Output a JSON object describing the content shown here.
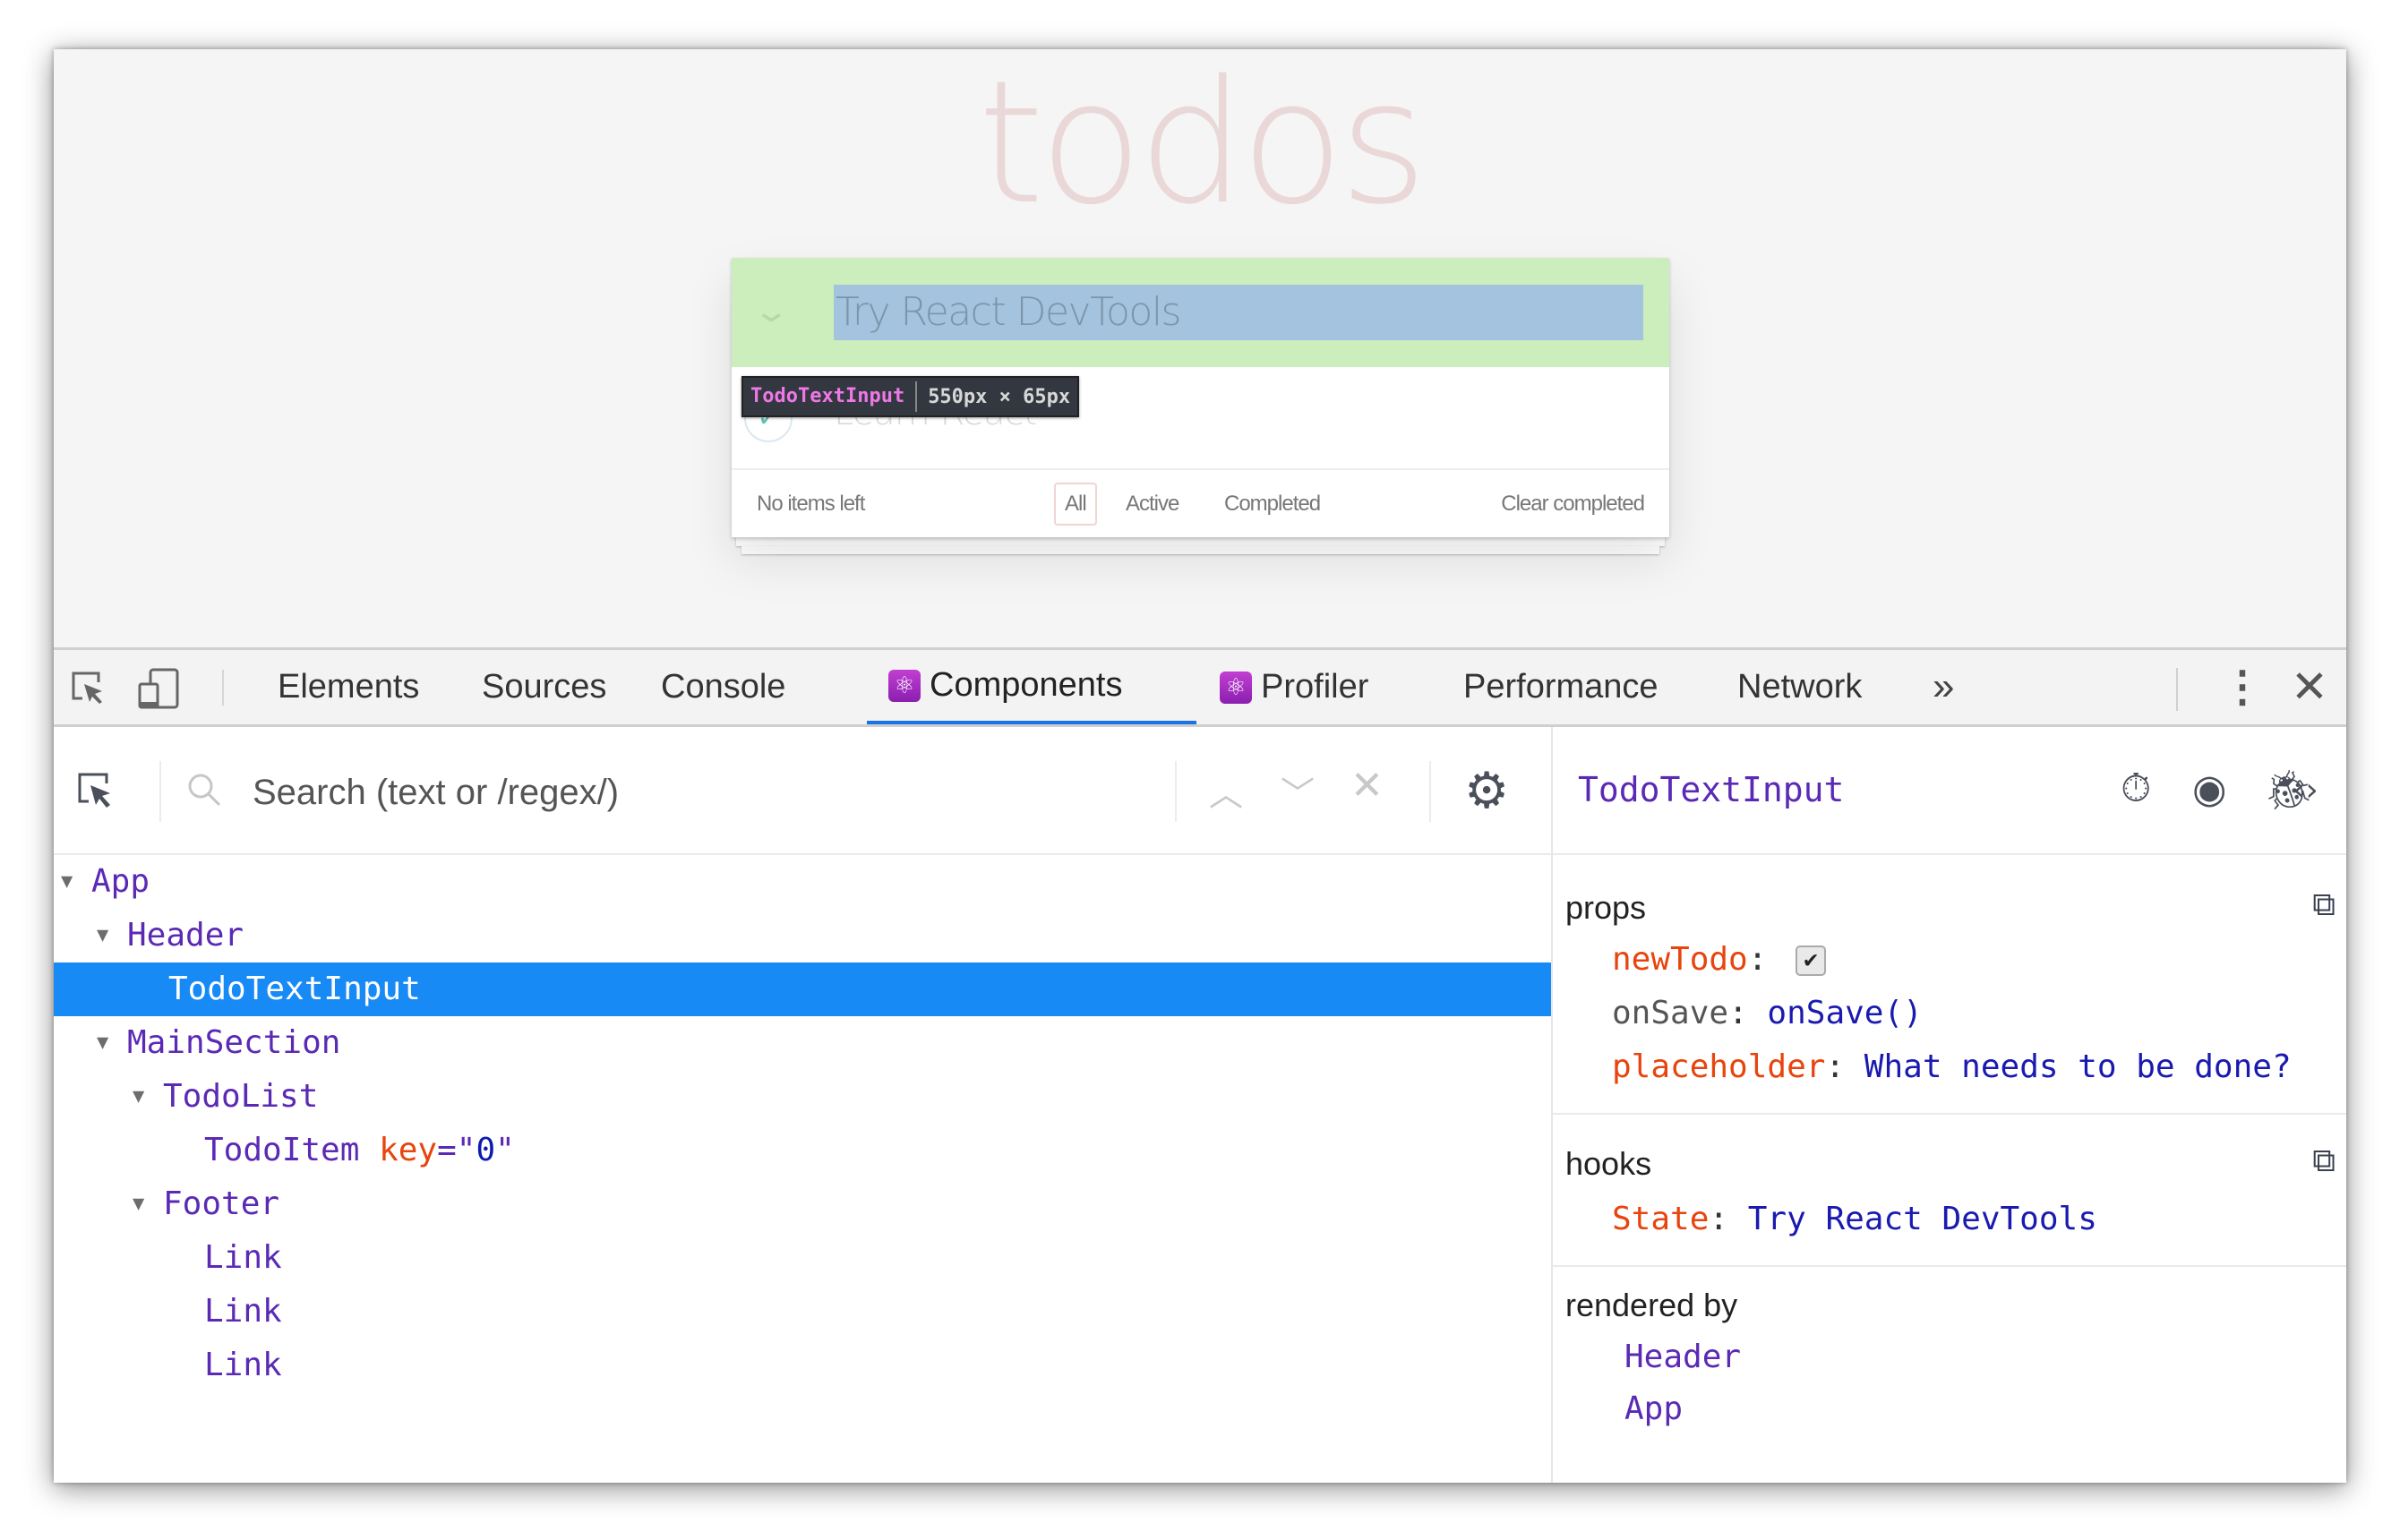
{
  "page": {
    "title": "todos",
    "new_todo_value": "Try React DevTools",
    "toggle_all_icon": "chevron-down-icon",
    "todos": [
      {
        "text": "Learn React",
        "completed": true
      }
    ],
    "footer": {
      "items_left": "No items left",
      "filters": [
        "All",
        "Active",
        "Completed"
      ],
      "selected_filter": "All",
      "clear_completed": "Clear completed"
    },
    "highlight_tooltip": {
      "component": "TodoTextInput",
      "size": "550px × 65px"
    }
  },
  "devtools": {
    "toolbar_icons": [
      "inspect-element-icon",
      "device-toggle-icon"
    ],
    "tabs": [
      {
        "label": "Elements",
        "react": false
      },
      {
        "label": "Sources",
        "react": false
      },
      {
        "label": "Console",
        "react": false
      },
      {
        "label": "Components",
        "react": true,
        "active": true
      },
      {
        "label": "Profiler",
        "react": true
      },
      {
        "label": "Performance",
        "react": false
      },
      {
        "label": "Network",
        "react": false
      }
    ],
    "more_tabs": "»",
    "menu_icon": "⋮",
    "close_icon": "✕",
    "search": {
      "placeholder": "Search (text or /regex/)",
      "value": ""
    },
    "tree": [
      {
        "name": "App",
        "depth": 0,
        "expanded": true
      },
      {
        "name": "Header",
        "depth": 1,
        "expanded": true
      },
      {
        "name": "TodoTextInput",
        "depth": 2,
        "selected": true
      },
      {
        "name": "MainSection",
        "depth": 1,
        "expanded": true
      },
      {
        "name": "TodoList",
        "depth": 2,
        "expanded": true
      },
      {
        "name": "TodoItem",
        "depth": 3,
        "key": "0"
      },
      {
        "name": "Footer",
        "depth": 2,
        "expanded": true
      },
      {
        "name": "Link",
        "depth": 3
      },
      {
        "name": "Link",
        "depth": 3
      },
      {
        "name": "Link",
        "depth": 3
      }
    ],
    "inspector": {
      "component": "TodoTextInput",
      "icons": [
        "stopwatch-icon",
        "eye-icon",
        "bug-icon",
        "source-code-icon"
      ],
      "props_title": "props",
      "props": [
        {
          "key": "newTodo",
          "type": "checkbox",
          "value": true
        },
        {
          "key": "onSave",
          "value": "onSave()",
          "plain_key": true
        },
        {
          "key": "placeholder",
          "value": "What needs to be done?"
        }
      ],
      "hooks_title": "hooks",
      "hooks": [
        {
          "key": "State",
          "value": "Try React DevTools"
        }
      ],
      "rendered_by_title": "rendered by",
      "rendered_by": [
        "Header",
        "App"
      ]
    }
  },
  "colors": {
    "selection": "#178af6",
    "active_tab_underline": "#1a73e8",
    "component_name": "#5b2ab5",
    "prop_key": "#e8440d",
    "prop_value": "#1a1ab0",
    "highlight_margin": "#cbeebc",
    "highlight_content": "#a3c3de",
    "tooltip_name": "#ee78e6"
  }
}
